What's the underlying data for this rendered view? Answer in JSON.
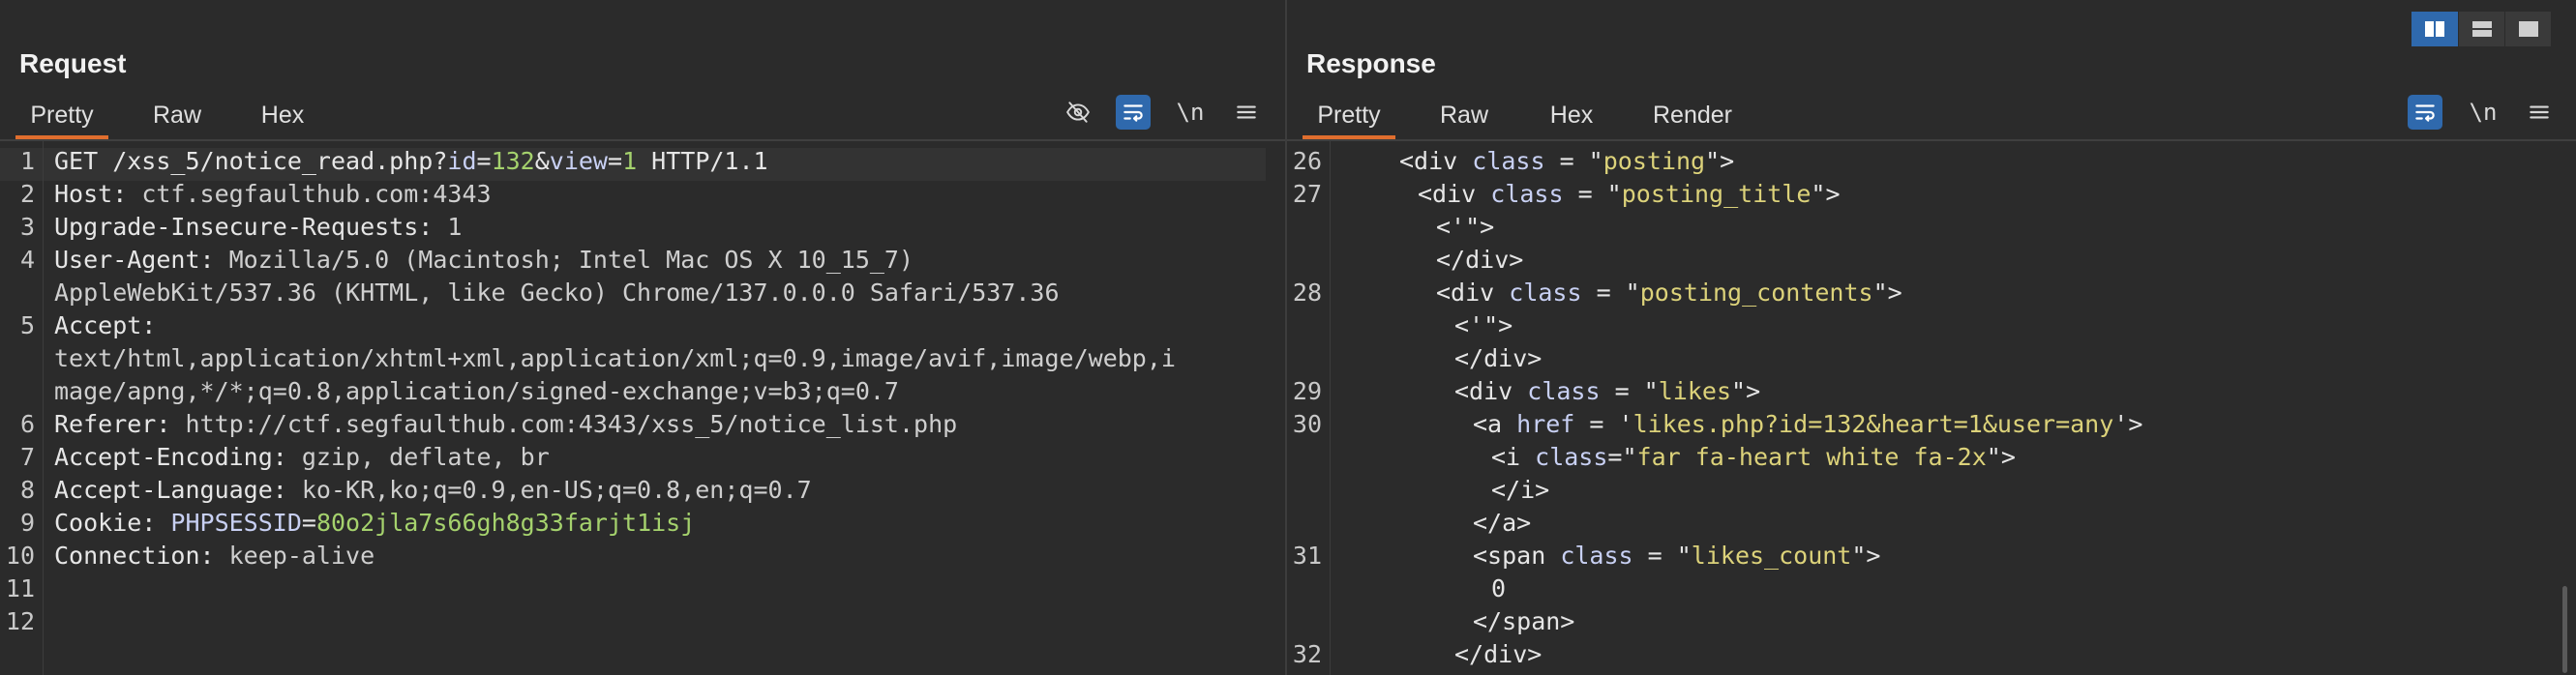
{
  "request": {
    "title": "Request",
    "tabs": [
      "Pretty",
      "Raw",
      "Hex"
    ],
    "active_tab": "Pretty",
    "toolbar": {
      "hide_icon": "eye-slash",
      "wrap_icon": "wrap-lines",
      "newline_label": "\\n",
      "menu_icon": "hamburger"
    },
    "line_numbers": [
      "1",
      "2",
      "3",
      "4",
      "5",
      "6",
      "7",
      "8",
      "9",
      "10",
      "11",
      "12"
    ],
    "lines": [
      [
        [
          "k",
          "GET /xss_5/notice_read.php?"
        ],
        [
          "param",
          "id"
        ],
        [
          "k",
          "="
        ],
        [
          "num",
          "132"
        ],
        [
          "k",
          "&"
        ],
        [
          "param",
          "view"
        ],
        [
          "k",
          "="
        ],
        [
          "num",
          "1"
        ],
        [
          "k",
          " HTTP/1.1"
        ]
      ],
      [
        [
          "k",
          "Host: "
        ],
        [
          "v",
          "ctf.segfaulthub.com:4343"
        ]
      ],
      [
        [
          "k",
          "Upgrade-Insecure-Requests: "
        ],
        [
          "v",
          "1"
        ]
      ],
      [
        [
          "k",
          "User-Agent: "
        ],
        [
          "v",
          "Mozilla/5.0 (Macintosh; Intel Mac OS X 10_15_7)"
        ]
      ],
      [
        [
          "v",
          "AppleWebKit/537.36 (KHTML, like Gecko) Chrome/137.0.0.0 Safari/537.36"
        ]
      ],
      [
        [
          "k",
          "Accept:"
        ]
      ],
      [
        [
          "v",
          "text/html,application/xhtml+xml,application/xml;q=0.9,image/avif,image/webp,i"
        ]
      ],
      [
        [
          "v",
          "mage/apng,*/*;q=0.8,application/signed-exchange;v=b3;q=0.7"
        ]
      ],
      [
        [
          "k",
          "Referer: "
        ],
        [
          "v",
          "http://ctf.segfaulthub.com:4343/xss_5/notice_list.php"
        ]
      ],
      [
        [
          "k",
          "Accept-Encoding: "
        ],
        [
          "v",
          "gzip, deflate, br"
        ]
      ],
      [
        [
          "k",
          "Accept-Language: "
        ],
        [
          "v",
          "ko-KR,ko;q=0.9,en-US;q=0.8,en;q=0.7"
        ]
      ],
      [
        [
          "k",
          "Cookie: "
        ],
        [
          "param",
          "PHPSESSID"
        ],
        [
          "k",
          "="
        ],
        [
          "num",
          "80o2jla7s66gh8g33farjt1isj"
        ]
      ],
      [
        [
          "k",
          "Connection: "
        ],
        [
          "v",
          "keep-alive"
        ]
      ]
    ]
  },
  "response": {
    "title": "Response",
    "tabs": [
      "Pretty",
      "Raw",
      "Hex",
      "Render"
    ],
    "active_tab": "Pretty",
    "toolbar": {
      "wrap_icon": "wrap-lines",
      "newline_label": "\\n",
      "menu_icon": "hamburger"
    },
    "line_numbers": [
      "26",
      "27",
      "28",
      "29",
      "30",
      "31",
      "32"
    ],
    "lines": [
      [
        [
          "tag",
          "<div "
        ],
        [
          "attr",
          "class"
        ],
        [
          "plain",
          " = \""
        ],
        [
          "str",
          "posting"
        ],
        [
          "plain",
          "\">"
        ]
      ],
      [
        [
          "tag",
          "<div "
        ],
        [
          "attr",
          "class"
        ],
        [
          "plain",
          " = \""
        ],
        [
          "str",
          "posting_title"
        ],
        [
          "plain",
          "\">"
        ]
      ],
      [
        [
          "plain",
          "<'\">"
        ]
      ],
      [
        [
          "tag",
          "</div>"
        ]
      ],
      [
        [
          "tag",
          "<div "
        ],
        [
          "attr",
          "class"
        ],
        [
          "plain",
          " = \""
        ],
        [
          "str",
          "posting_contents"
        ],
        [
          "plain",
          "\">"
        ]
      ],
      [
        [
          "plain",
          "<'\">"
        ]
      ],
      [
        [
          "tag",
          "</div>"
        ]
      ],
      [
        [
          "tag",
          "<div "
        ],
        [
          "attr",
          "class"
        ],
        [
          "plain",
          " = \""
        ],
        [
          "str",
          "likes"
        ],
        [
          "plain",
          "\">"
        ]
      ],
      [
        [
          "tag",
          "<a "
        ],
        [
          "attr",
          "href"
        ],
        [
          "plain",
          " = '"
        ],
        [
          "str",
          "likes.php?id=132&heart=1&user=any"
        ],
        [
          "plain",
          "'>"
        ]
      ],
      [
        [
          "tag",
          "<i "
        ],
        [
          "attr",
          "class"
        ],
        [
          "plain",
          "=\""
        ],
        [
          "str",
          "far fa-heart white fa-2x"
        ],
        [
          "plain",
          "\">"
        ]
      ],
      [
        [
          "tag",
          "</i>"
        ]
      ],
      [
        [
          "tag",
          "</a>"
        ]
      ],
      [
        [
          "tag",
          "<span "
        ],
        [
          "attr",
          "class"
        ],
        [
          "plain",
          " = \""
        ],
        [
          "str",
          "likes_count"
        ],
        [
          "plain",
          "\">"
        ]
      ],
      [
        [
          "plain",
          "0"
        ]
      ],
      [
        [
          "tag",
          "</span>"
        ]
      ],
      [
        [
          "tag",
          "</div>"
        ]
      ]
    ]
  },
  "layout_switcher": {
    "options": [
      "side-by-side",
      "stacked",
      "single"
    ],
    "active": "side-by-side"
  }
}
